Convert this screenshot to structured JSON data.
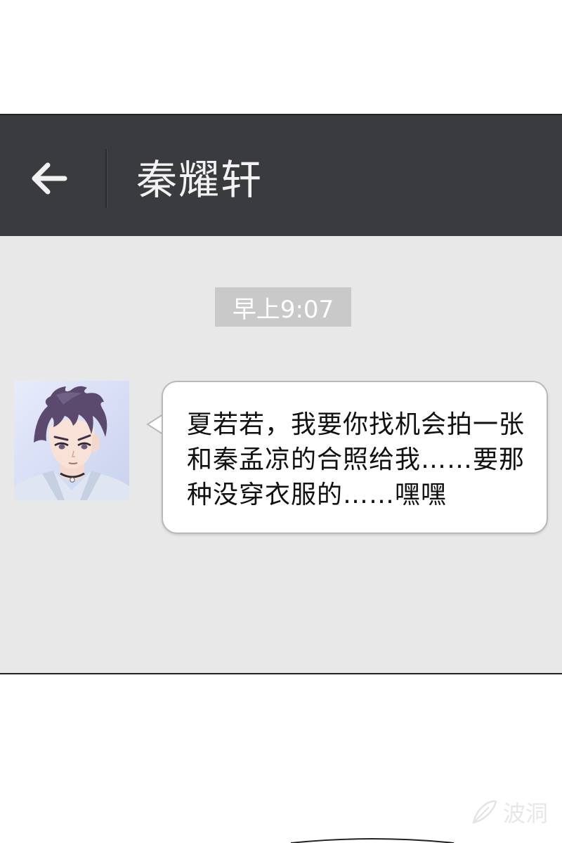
{
  "header": {
    "back_icon": "left-arrow-icon",
    "title": "秦耀轩"
  },
  "chat": {
    "timestamp": "早上9:07",
    "messages": [
      {
        "sender_avatar": "avatar",
        "lines": [
          "夏若若，我要你找机会拍一张",
          "和秦孟凉的合照给我……要那",
          "种没穿衣服的……嘿嘿"
        ]
      }
    ]
  },
  "watermark": {
    "icon": "feather-logo-icon",
    "text": "波洞"
  },
  "colors": {
    "header_bg": "#3a3b3f",
    "chat_bg": "#e8e8e8",
    "timestamp_bg": "#c9c9c9",
    "bubble_bg": "#ffffff"
  }
}
